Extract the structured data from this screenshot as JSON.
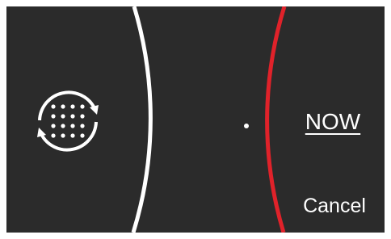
{
  "actions": {
    "now_label": "NOW",
    "cancel_label": "Cancel"
  },
  "icons": {
    "sync": "sync-icon"
  },
  "colors": {
    "background": "#2b2b2b",
    "left_arc": "#ffffff",
    "right_arc": "#e0222a",
    "text": "#ffffff"
  }
}
